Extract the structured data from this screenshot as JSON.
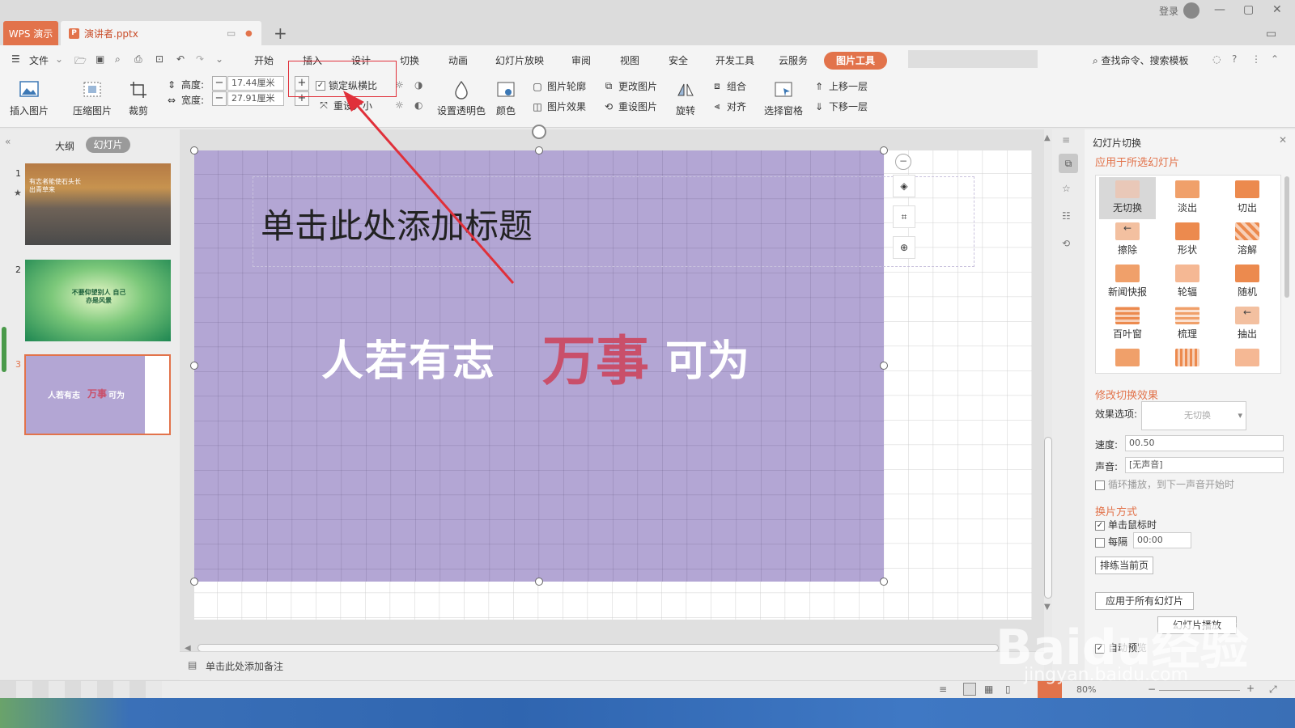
{
  "titlebar": {
    "app_tab": "WPS 演示",
    "doc_tab": "演讲者.pptx",
    "login": "登录",
    "new_tab": "+"
  },
  "menu": {
    "file": "文件",
    "items": [
      "开始",
      "插入",
      "设计",
      "切换",
      "动画",
      "幻灯片放映",
      "审阅",
      "视图",
      "安全",
      "开发工具",
      "云服务"
    ],
    "picture_tools": "图片工具",
    "search": "查找命令、搜索模板"
  },
  "ribbon": {
    "insert_picture": "插入图片",
    "compress": "压缩图片",
    "crop": "裁剪",
    "height_label": "高度:",
    "height_value": "17.44厘米",
    "width_label": "宽度:",
    "width_value": "27.91厘米",
    "lock_ratio": "锁定纵横比",
    "reset_size": "重设大小",
    "set_transparent": "设置透明色",
    "color": "颜色",
    "picture_outline": "图片轮廓",
    "picture_effect": "图片效果",
    "change_picture": "更改图片",
    "reset_picture": "重设图片",
    "rotate": "旋转",
    "group": "组合",
    "align": "对齐",
    "selection_pane": "选择窗格",
    "bring_forward": "上移一层",
    "send_backward": "下移一层"
  },
  "leftpanel": {
    "tab_outline": "大纲",
    "tab_slides": "幻灯片",
    "slides": [
      {
        "num": "1",
        "text": "有志者能使石头长出青草来"
      },
      {
        "num": "2",
        "text": "不要仰望别人 自己亦是风景"
      },
      {
        "num": "3",
        "text1": "人若有志",
        "text2": "万事",
        "text3": "可为"
      }
    ]
  },
  "slide": {
    "title_placeholder": "单击此处添加标题",
    "motto_part1": "人若有志",
    "motto_part2": "万事",
    "motto_part3": "可为"
  },
  "notes": {
    "placeholder": "单击此处添加备注"
  },
  "rightpanel": {
    "header": "幻灯片切换",
    "apply_selected": "应用于所选幻灯片",
    "transitions": [
      "无切换",
      "淡出",
      "切出",
      "擦除",
      "形状",
      "溶解",
      "新闻快报",
      "轮辐",
      "随机",
      "百叶窗",
      "梳理",
      "抽出"
    ],
    "modify_effect": "修改切换效果",
    "effect_option_label": "效果选项:",
    "effect_option_value": "无切换",
    "speed_label": "速度:",
    "speed_value": "00.50",
    "sound_label": "声音:",
    "sound_value": "[无声音]",
    "loop_text": "循环播放，到下一声音开始时",
    "advance_header": "换片方式",
    "on_click": "单击鼠标时",
    "every": "每隔",
    "every_value": "00:00",
    "rehearse": "排练当前页",
    "apply_all": "应用于所有幻灯片",
    "play": "幻灯片播放",
    "autopreview": "自动预览"
  },
  "statusbar": {
    "zoom": "80%"
  },
  "watermark": {
    "main": "Baidu经验",
    "sub": "jingyan.baidu.com"
  },
  "colors": {
    "accent": "#e2734b",
    "picture_fill": "#b3a6d4",
    "motto_red": "#c94f6a",
    "annotation_red": "#e0303a"
  }
}
